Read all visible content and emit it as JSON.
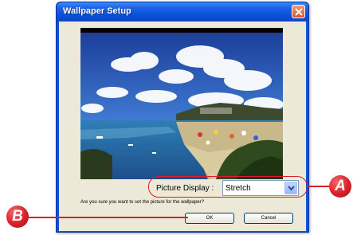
{
  "dialog": {
    "title": "Wallpaper Setup",
    "preview": {
      "icon": "landscape-photo",
      "description": ""
    },
    "picture_display": {
      "label": "Picture Display :",
      "selected": "Stretch"
    },
    "question": "Are you sure you want to set the picture for the wallpaper?",
    "ok_label": "OK",
    "cancel_label": "Cancel"
  },
  "callouts": {
    "a": "A",
    "b": "B",
    "color": "#d8202a"
  }
}
